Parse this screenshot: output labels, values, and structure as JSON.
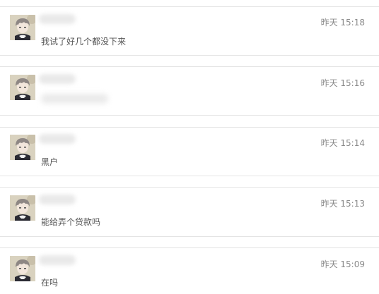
{
  "messages": [
    {
      "time": "昨天 15:18",
      "text": "我试了好几个都没下来"
    },
    {
      "time": "昨天 15:16",
      "text": ""
    },
    {
      "time": "昨天 15:14",
      "text": "黑户"
    },
    {
      "time": "昨天 15:13",
      "text": "能给弄个贷款吗"
    },
    {
      "time": "昨天 15:09",
      "text": "在吗"
    }
  ],
  "icons": {
    "avatar": "anime-boy-avatar-icon"
  }
}
